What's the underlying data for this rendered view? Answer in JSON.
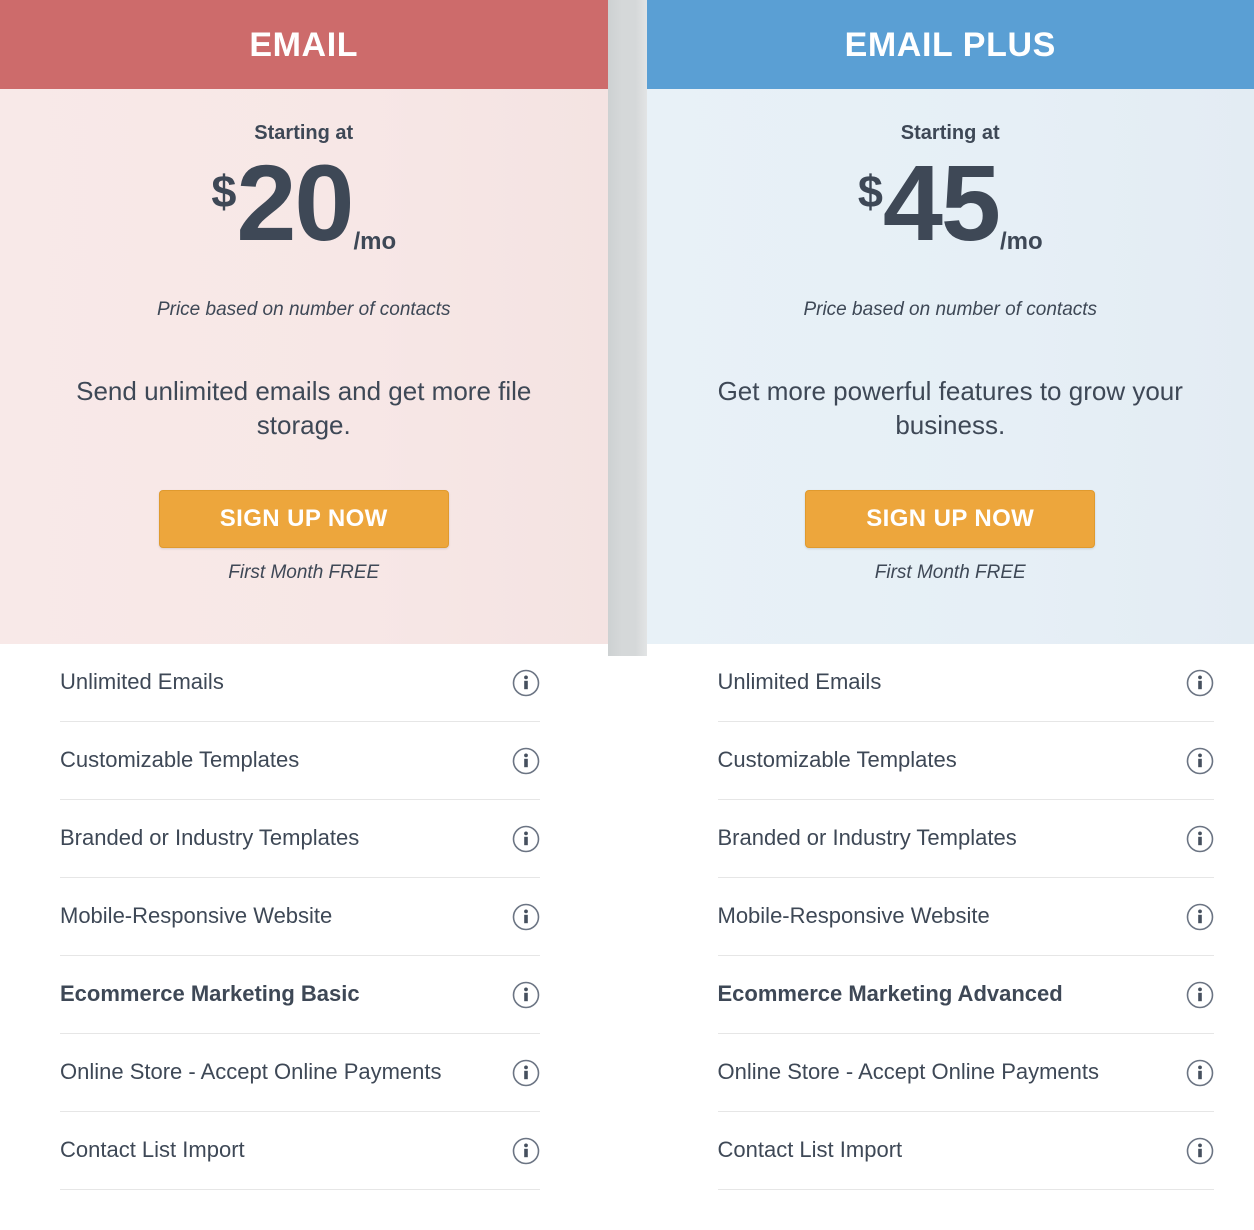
{
  "colors": {
    "email_header": "#cd6b6b",
    "email_panel": "#f7e8e7",
    "emailplus_header": "#5a9fd4",
    "emailplus_panel": "#e6f0f6",
    "cta_button": "#eda63c",
    "text_dark": "#3e4856",
    "divider": "#e6e6e6",
    "gap_strip": "#d5d8d9"
  },
  "plans": [
    {
      "name": "EMAIL",
      "starting_label": "Starting at",
      "currency": "$",
      "price": "20",
      "period": "/mo",
      "price_note": "Price based on number of contacts",
      "pitch": "Send unlimited emails and get more file storage.",
      "cta_label": "SIGN UP NOW",
      "cta_subtext": "First Month FREE",
      "features": [
        {
          "label": "Unlimited Emails",
          "emphasis": false,
          "icon": "info-icon"
        },
        {
          "label": "Customizable Templates",
          "emphasis": false,
          "icon": "info-icon"
        },
        {
          "label": "Branded or Industry Templates",
          "emphasis": false,
          "icon": "info-icon"
        },
        {
          "label": "Mobile-Responsive Website",
          "emphasis": false,
          "icon": "info-icon"
        },
        {
          "label": "Ecommerce Marketing Basic",
          "emphasis": true,
          "icon": "info-icon"
        },
        {
          "label": "Online Store - Accept Online Payments",
          "emphasis": false,
          "icon": "info-icon"
        },
        {
          "label": "Contact List Import",
          "emphasis": false,
          "icon": "info-icon"
        }
      ]
    },
    {
      "name": "EMAIL PLUS",
      "starting_label": "Starting at",
      "currency": "$",
      "price": "45",
      "period": "/mo",
      "price_note": "Price based on number of contacts",
      "pitch": "Get more powerful features to grow your business.",
      "cta_label": "SIGN UP NOW",
      "cta_subtext": "First Month FREE",
      "features": [
        {
          "label": "Unlimited Emails",
          "emphasis": false,
          "icon": "info-icon"
        },
        {
          "label": "Customizable Templates",
          "emphasis": false,
          "icon": "info-icon"
        },
        {
          "label": "Branded or Industry Templates",
          "emphasis": false,
          "icon": "info-icon"
        },
        {
          "label": "Mobile-Responsive Website",
          "emphasis": false,
          "icon": "info-icon"
        },
        {
          "label": "Ecommerce Marketing Advanced",
          "emphasis": true,
          "icon": "info-icon"
        },
        {
          "label": "Online Store - Accept Online Payments",
          "emphasis": false,
          "icon": "info-icon"
        },
        {
          "label": "Contact List Import",
          "emphasis": false,
          "icon": "info-icon"
        }
      ]
    }
  ]
}
